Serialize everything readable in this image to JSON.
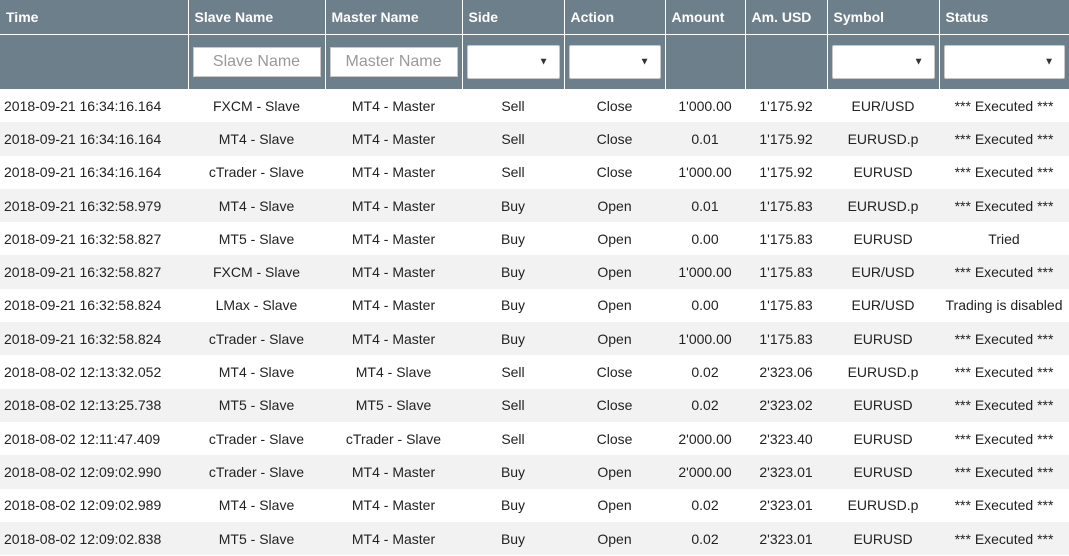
{
  "headers": {
    "time": "Time",
    "slave": "Slave Name",
    "master": "Master Name",
    "side": "Side",
    "action": "Action",
    "amount": "Amount",
    "amusd": "Am. USD",
    "symbol": "Symbol",
    "status": "Status"
  },
  "filters": {
    "slave_placeholder": "Slave Name",
    "master_placeholder": "Master Name",
    "side_value": "",
    "action_value": "",
    "symbol_value": "",
    "status_value": ""
  },
  "colors": {
    "header_bg": "#6e7f8c",
    "row_alt": "#f2f2f2"
  },
  "rows": [
    {
      "time": "2018-09-21 16:34:16.164",
      "slave": "FXCM - Slave",
      "master": "MT4 - Master",
      "side": "Sell",
      "action": "Close",
      "amount": "1'000.00",
      "amusd": "1'175.92",
      "symbol": "EUR/USD",
      "status": "*** Executed ***"
    },
    {
      "time": "2018-09-21 16:34:16.164",
      "slave": "MT4 - Slave",
      "master": "MT4 - Master",
      "side": "Sell",
      "action": "Close",
      "amount": "0.01",
      "amusd": "1'175.92",
      "symbol": "EURUSD.p",
      "status": "*** Executed ***"
    },
    {
      "time": "2018-09-21 16:34:16.164",
      "slave": "cTrader - Slave",
      "master": "MT4 - Master",
      "side": "Sell",
      "action": "Close",
      "amount": "1'000.00",
      "amusd": "1'175.92",
      "symbol": "EURUSD",
      "status": "*** Executed ***"
    },
    {
      "time": "2018-09-21 16:32:58.979",
      "slave": "MT4 - Slave",
      "master": "MT4 - Master",
      "side": "Buy",
      "action": "Open",
      "amount": "0.01",
      "amusd": "1'175.83",
      "symbol": "EURUSD.p",
      "status": "*** Executed ***"
    },
    {
      "time": "2018-09-21 16:32:58.827",
      "slave": "MT5 - Slave",
      "master": "MT4 - Master",
      "side": "Buy",
      "action": "Open",
      "amount": "0.00",
      "amusd": "1'175.83",
      "symbol": "EURUSD",
      "status": "Tried"
    },
    {
      "time": "2018-09-21 16:32:58.827",
      "slave": "FXCM - Slave",
      "master": "MT4 - Master",
      "side": "Buy",
      "action": "Open",
      "amount": "1'000.00",
      "amusd": "1'175.83",
      "symbol": "EUR/USD",
      "status": "*** Executed ***"
    },
    {
      "time": "2018-09-21 16:32:58.824",
      "slave": "LMax - Slave",
      "master": "MT4 - Master",
      "side": "Buy",
      "action": "Open",
      "amount": "0.00",
      "amusd": "1'175.83",
      "symbol": "EUR/USD",
      "status": "Trading is disabled"
    },
    {
      "time": "2018-09-21 16:32:58.824",
      "slave": "cTrader - Slave",
      "master": "MT4 - Master",
      "side": "Buy",
      "action": "Open",
      "amount": "1'000.00",
      "amusd": "1'175.83",
      "symbol": "EURUSD",
      "status": "*** Executed ***"
    },
    {
      "time": "2018-08-02 12:13:32.052",
      "slave": "MT4 - Slave",
      "master": "MT4 - Slave",
      "side": "Sell",
      "action": "Close",
      "amount": "0.02",
      "amusd": "2'323.06",
      "symbol": "EURUSD.p",
      "status": "*** Executed ***"
    },
    {
      "time": "2018-08-02 12:13:25.738",
      "slave": "MT5 - Slave",
      "master": "MT5 - Slave",
      "side": "Sell",
      "action": "Close",
      "amount": "0.02",
      "amusd": "2'323.02",
      "symbol": "EURUSD",
      "status": "*** Executed ***"
    },
    {
      "time": "2018-08-02 12:11:47.409",
      "slave": "cTrader - Slave",
      "master": "cTrader - Slave",
      "side": "Sell",
      "action": "Close",
      "amount": "2'000.00",
      "amusd": "2'323.40",
      "symbol": "EURUSD",
      "status": "*** Executed ***"
    },
    {
      "time": "2018-08-02 12:09:02.990",
      "slave": "cTrader - Slave",
      "master": "MT4 - Master",
      "side": "Buy",
      "action": "Open",
      "amount": "2'000.00",
      "amusd": "2'323.01",
      "symbol": "EURUSD",
      "status": "*** Executed ***"
    },
    {
      "time": "2018-08-02 12:09:02.989",
      "slave": "MT4 - Slave",
      "master": "MT4 - Master",
      "side": "Buy",
      "action": "Open",
      "amount": "0.02",
      "amusd": "2'323.01",
      "symbol": "EURUSD.p",
      "status": "*** Executed ***"
    },
    {
      "time": "2018-08-02 12:09:02.838",
      "slave": "MT5 - Slave",
      "master": "MT4 - Master",
      "side": "Buy",
      "action": "Open",
      "amount": "0.02",
      "amusd": "2'323.01",
      "symbol": "EURUSD",
      "status": "*** Executed ***"
    }
  ]
}
